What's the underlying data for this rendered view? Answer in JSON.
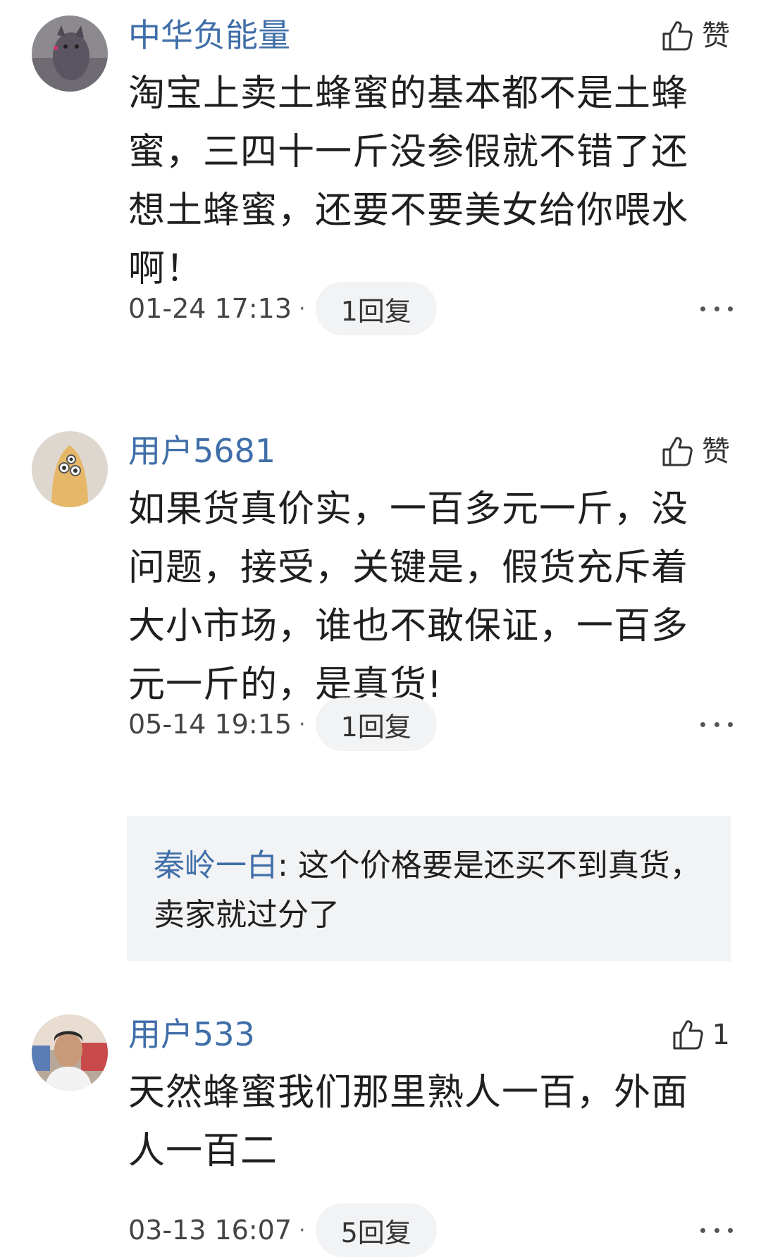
{
  "comments": [
    {
      "username": "中华负能量",
      "like_label": "赞",
      "content": "淘宝上卖土蜂蜜的基本都不是土蜂蜜，三四十一斤没参假就不错了还想土蜂蜜，还要不要美女给你喂水啊！",
      "time": "01-24 17:13",
      "separator": "·",
      "reply_label": "1回复"
    },
    {
      "username": "用户5681",
      "like_label": "赞",
      "content": "如果货真价实，一百多元一斤，没问题，接受，关键是，假货充斥着大小市场，谁也不敢保证，一百多元一斤的，是真货!",
      "time": "05-14 19:15",
      "separator": "·",
      "reply_label": "1回复",
      "reply": {
        "author": "秦岭一白",
        "colon": ": ",
        "text": "这个价格要是还买不到真货，卖家就过分了"
      }
    },
    {
      "username": "用户533",
      "like_label": "1",
      "content": "天然蜂蜜我们那里熟人一百，外面人一百二",
      "time": "03-13 16:07",
      "separator": "·",
      "reply_label": "5回复"
    }
  ],
  "icons": {
    "like": "thumbs-up-icon",
    "more": "more-dots-icon"
  },
  "colors": {
    "username": "#3f6ea8",
    "pill_background": "#f2f3f5",
    "text": "#1f1f1f"
  }
}
